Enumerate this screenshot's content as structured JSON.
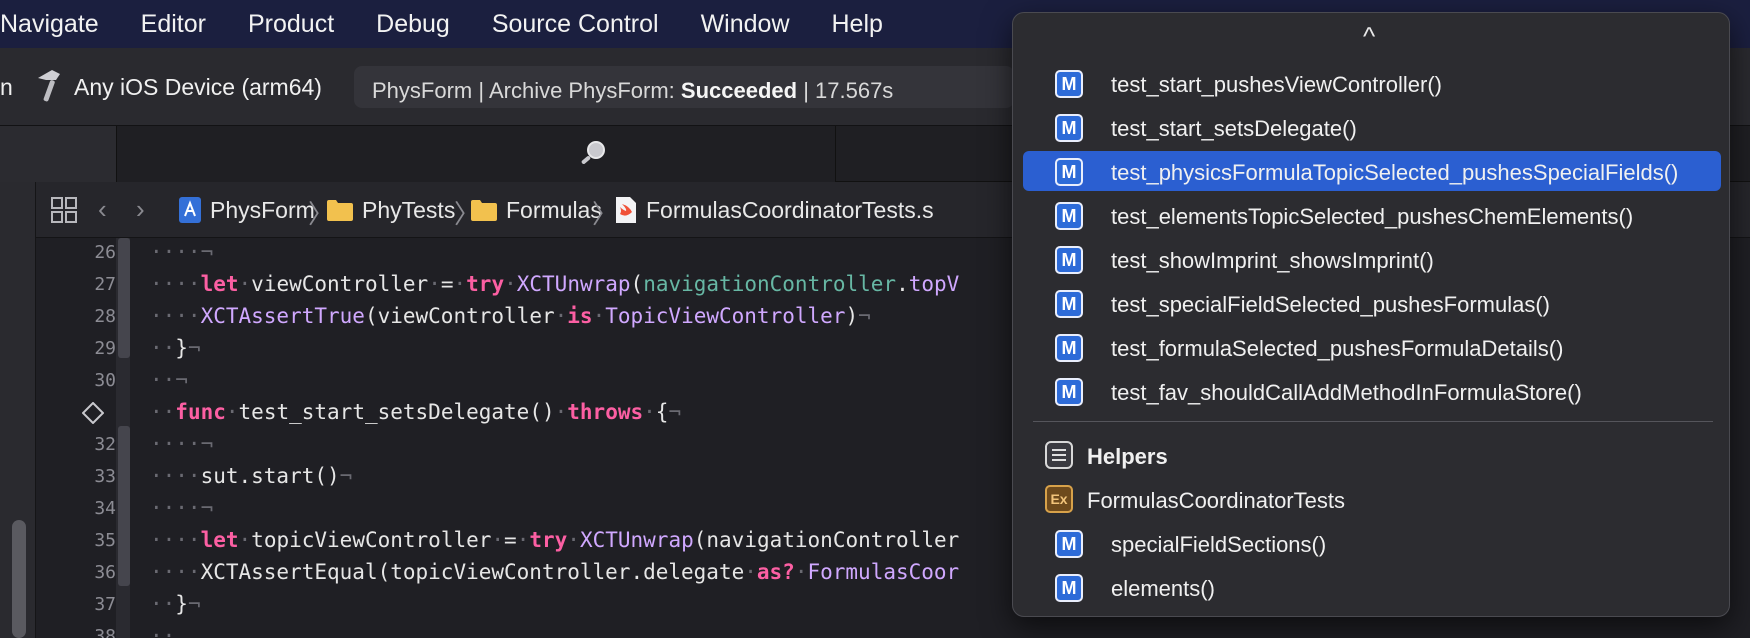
{
  "menubar": {
    "items": [
      "Navigate",
      "Editor",
      "Product",
      "Debug",
      "Source Control",
      "Window",
      "Help"
    ]
  },
  "toolbar": {
    "scheme_fragment": "n",
    "device": "Any iOS Device (arm64)",
    "status": {
      "prefix": "PhysForm | Archive PhysForm: ",
      "result": "Succeeded",
      "suffix": " | 17.567s"
    }
  },
  "jumpbar": {
    "crumbs": [
      "PhysForm",
      "PhyTests",
      "Formulas",
      "FormulasCoordinatorTests.s"
    ]
  },
  "editor": {
    "line_numbers": [
      "26",
      "27",
      "28",
      "29",
      "30",
      "",
      "32",
      "33",
      "34",
      "35",
      "36",
      "37",
      "38"
    ],
    "lines": [
      {
        "parts": [
          {
            "t": "····¬",
            "c": "inv"
          }
        ]
      },
      {
        "parts": [
          {
            "t": "····",
            "c": "inv"
          },
          {
            "t": "let",
            "c": "kw"
          },
          {
            "t": "·",
            "c": "inv"
          },
          {
            "t": "viewController",
            "c": ""
          },
          {
            "t": "·",
            "c": "inv"
          },
          {
            "t": "=",
            "c": ""
          },
          {
            "t": "·",
            "c": "inv"
          },
          {
            "t": "try",
            "c": "kw"
          },
          {
            "t": "·",
            "c": "inv"
          },
          {
            "t": "XCTUnwrap",
            "c": "ty"
          },
          {
            "t": "(",
            "c": ""
          },
          {
            "t": "navigationController",
            "c": "fn"
          },
          {
            "t": ".",
            "c": ""
          },
          {
            "t": "topV",
            "c": "ty"
          }
        ]
      },
      {
        "parts": [
          {
            "t": "····",
            "c": "inv"
          },
          {
            "t": "XCTAssertTrue",
            "c": "ty"
          },
          {
            "t": "(viewController",
            "c": ""
          },
          {
            "t": "·",
            "c": "inv"
          },
          {
            "t": "is",
            "c": "kw"
          },
          {
            "t": "·",
            "c": "inv"
          },
          {
            "t": "TopicViewController",
            "c": "ty"
          },
          {
            "t": ")",
            "c": ""
          },
          {
            "t": "¬",
            "c": "inv"
          }
        ]
      },
      {
        "parts": [
          {
            "t": "··",
            "c": "inv"
          },
          {
            "t": "}",
            "c": ""
          },
          {
            "t": "¬",
            "c": "inv"
          }
        ]
      },
      {
        "parts": [
          {
            "t": "··¬",
            "c": "inv"
          }
        ]
      },
      {
        "parts": [
          {
            "t": "··",
            "c": "inv"
          },
          {
            "t": "func",
            "c": "kw"
          },
          {
            "t": "·",
            "c": "inv"
          },
          {
            "t": "test_start_setsDelegate()",
            "c": ""
          },
          {
            "t": "·",
            "c": "inv"
          },
          {
            "t": "throws",
            "c": "kw"
          },
          {
            "t": "·",
            "c": "inv"
          },
          {
            "t": "{",
            "c": ""
          },
          {
            "t": "¬",
            "c": "inv"
          }
        ]
      },
      {
        "parts": [
          {
            "t": "····¬",
            "c": "inv"
          }
        ]
      },
      {
        "parts": [
          {
            "t": "····",
            "c": "inv"
          },
          {
            "t": "sut.start()",
            "c": ""
          },
          {
            "t": "¬",
            "c": "inv"
          }
        ]
      },
      {
        "parts": [
          {
            "t": "····¬",
            "c": "inv"
          }
        ]
      },
      {
        "parts": [
          {
            "t": "····",
            "c": "inv"
          },
          {
            "t": "let",
            "c": "kw"
          },
          {
            "t": "·",
            "c": "inv"
          },
          {
            "t": "topicViewController",
            "c": ""
          },
          {
            "t": "·",
            "c": "inv"
          },
          {
            "t": "=",
            "c": ""
          },
          {
            "t": "·",
            "c": "inv"
          },
          {
            "t": "try",
            "c": "kw"
          },
          {
            "t": "·",
            "c": "inv"
          },
          {
            "t": "XCTUnwrap",
            "c": "ty"
          },
          {
            "t": "(navigationController",
            "c": ""
          }
        ]
      },
      {
        "parts": [
          {
            "t": "····",
            "c": "inv"
          },
          {
            "t": "XCTAssertEqual(topicViewController.delegate",
            "c": ""
          },
          {
            "t": "·",
            "c": "inv"
          },
          {
            "t": "as?",
            "c": "kw"
          },
          {
            "t": "·",
            "c": "inv"
          },
          {
            "t": "FormulasCoor",
            "c": "ty"
          }
        ]
      },
      {
        "parts": [
          {
            "t": "··",
            "c": "inv"
          },
          {
            "t": "}",
            "c": ""
          },
          {
            "t": "¬",
            "c": "inv"
          }
        ]
      },
      {
        "parts": [
          {
            "t": "··",
            "c": "inv"
          }
        ]
      }
    ]
  },
  "popover": {
    "scroll_up_glyph": "^",
    "methods": [
      "test_start_pushesViewController()",
      "test_start_setsDelegate()",
      "test_physicsFormulaTopicSelected_pushesSpecialFields()",
      "test_elementsTopicSelected_pushesChemElements()",
      "test_showImprint_showsImprint()",
      "test_specialFieldSelected_pushesFormulas()",
      "test_formulaSelected_pushesFormulaDetails()",
      "test_fav_shouldCallAddMethodInFormulaStore()"
    ],
    "selected_index": 2,
    "method_badge": "M",
    "helpers_label": "Helpers",
    "extension_badge": "Ex",
    "extension_label": "FormulasCoordinatorTests",
    "helper_methods": [
      "specialFieldSections()",
      "elements()"
    ]
  },
  "colors": {
    "menubar_bg": "#1b1f3f",
    "selection": "#2b5fd1",
    "keyword": "#fc5fa3",
    "type": "#d0a8ff",
    "func_ref": "#67b7a4"
  }
}
